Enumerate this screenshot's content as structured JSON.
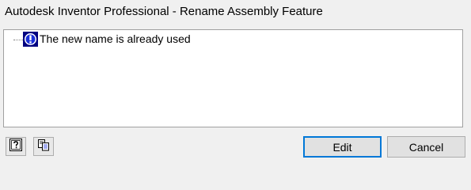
{
  "window": {
    "title": "Autodesk Inventor Professional - Rename Assembly Feature"
  },
  "messages": [
    {
      "icon": "info-alert-icon",
      "text": "The new name is already used"
    }
  ],
  "footer": {
    "help_icon": "help-icon",
    "copy_icon": "copy-icon",
    "edit_label": "Edit",
    "cancel_label": "Cancel"
  },
  "colors": {
    "accent": "#0078d7",
    "icon_background": "#000080"
  }
}
